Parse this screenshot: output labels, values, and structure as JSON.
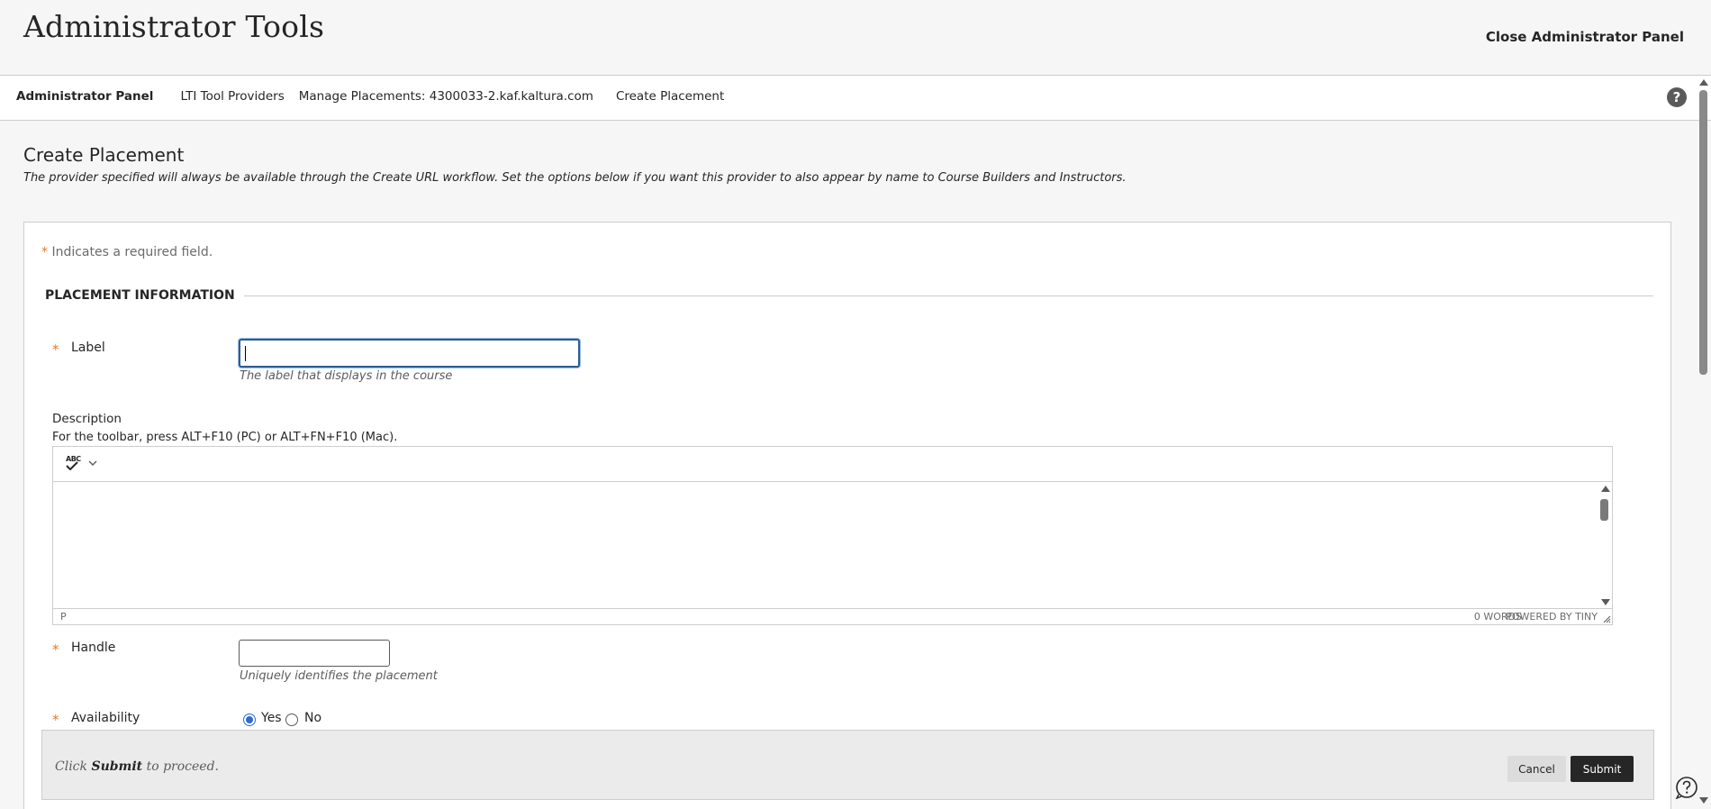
{
  "header": {
    "title": "Administrator Tools",
    "close_label": "Close Administrator Panel"
  },
  "breadcrumbs": [
    {
      "label": "Administrator Panel"
    },
    {
      "label": "LTI Tool Providers"
    },
    {
      "label": "Manage Placements: 4300033-2.kaf.kaltura.com"
    },
    {
      "label": "Create Placement"
    }
  ],
  "help_label": "?",
  "page": {
    "title": "Create Placement",
    "description": "The provider specified will always be available through the Create URL workflow. Set the options below if you want this provider to also appear by name to Course Builders and Instructors."
  },
  "form": {
    "required_star": "*",
    "required_note": "Indicates a required field.",
    "section_title": "PLACEMENT INFORMATION",
    "label_field": {
      "label": "Label",
      "value": "",
      "hint": "The label that displays in the course"
    },
    "description_field": {
      "label": "Description",
      "toolbar_hint": "For the toolbar, press ALT+F10 (PC) or ALT+FN+F10 (Mac).",
      "spellcheck_icon_text": "ABC",
      "status_path": "P",
      "word_count": "0 WORDS",
      "powered_by": "POWERED BY TINY"
    },
    "handle_field": {
      "label": "Handle",
      "value": "",
      "hint": "Uniquely identifies the placement"
    },
    "availability_field": {
      "label": "Availability",
      "options": [
        {
          "label": "Yes",
          "selected": true
        },
        {
          "label": "No",
          "selected": false
        }
      ]
    }
  },
  "submit_bar": {
    "prefix": "Click ",
    "action_word": "Submit",
    "suffix": " to proceed.",
    "cancel_label": "Cancel",
    "submit_label": "Submit"
  },
  "colors": {
    "accent_star": "#e07b2e",
    "focus_border": "#2c5d96",
    "radio_selected": "#2c6bd1",
    "submit_button": "#262626"
  }
}
